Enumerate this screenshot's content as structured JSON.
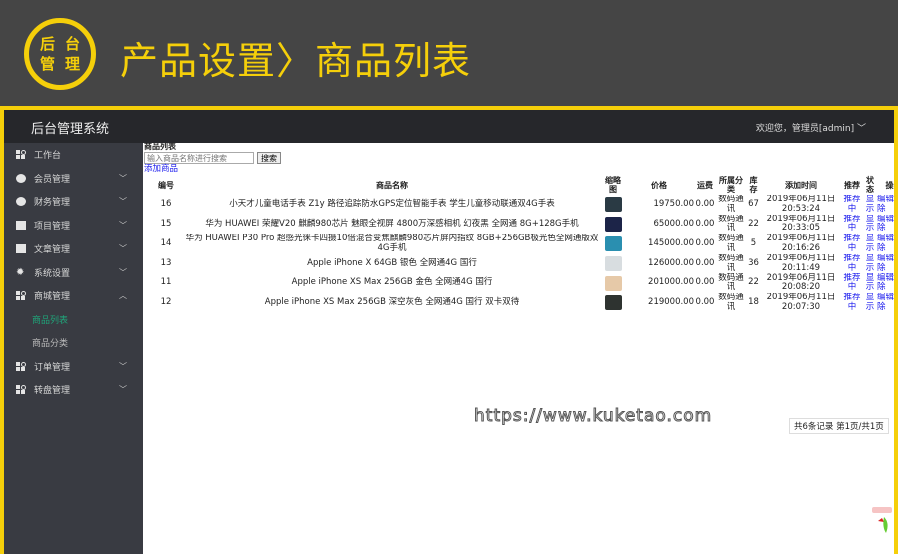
{
  "banner": {
    "seal_chars": [
      "后",
      "台",
      "管",
      "理"
    ],
    "title": "产品设置〉商品列表"
  },
  "header": {
    "system_name": "后台管理系统",
    "welcome": "欢迎您，管理员[admin]",
    "dropdown_icon": "chevron-down-icon"
  },
  "sidebar": {
    "items": [
      {
        "label": "工作台",
        "icon": "grid-icon"
      },
      {
        "label": "会员管理",
        "icon": "user-circle-icon",
        "chevron": "down"
      },
      {
        "label": "财务管理",
        "icon": "money-icon",
        "chevron": "down"
      },
      {
        "label": "项目管理",
        "icon": "project-icon",
        "chevron": "down"
      },
      {
        "label": "文章管理",
        "icon": "document-icon",
        "chevron": "down"
      },
      {
        "label": "系统设置",
        "icon": "gear-icon",
        "chevron": "down"
      },
      {
        "label": "商城管理",
        "icon": "grid-icon",
        "chevron": "up",
        "children": [
          {
            "label": "商品列表",
            "active": true
          },
          {
            "label": "商品分类"
          }
        ]
      },
      {
        "label": "订单管理",
        "icon": "grid-icon",
        "chevron": "down"
      },
      {
        "label": "转盘管理",
        "icon": "grid-icon",
        "chevron": "down"
      }
    ]
  },
  "main": {
    "breadcrumb": "商品列表",
    "search_placeholder": "输入商品名称进行搜索",
    "search_button": "搜索",
    "add_link": "添加商品",
    "columns": [
      "编号",
      "商品名称",
      "缩略图",
      "价格",
      "运费",
      "所属分类",
      "库存",
      "添加时间",
      "推荐",
      "状态",
      "操作"
    ],
    "rows": [
      {
        "id": "16",
        "name": "小天才儿童电话手表 Z1y 路径追踪防水GPS定位智能手表 学生儿童移动联通双4G手表",
        "price": "19750.00",
        "freight": "0.00",
        "category": "数码通讯",
        "stock": "67",
        "time": "2019年06月11日 20:53:24",
        "recommend": "推荐中",
        "status": "显示",
        "edit": "编辑",
        "delete": "删除",
        "thumb": "#2a3a44"
      },
      {
        "id": "15",
        "name": "华为 HUAWEI 荣耀V20 麒麟980芯片 魅眼全视屏 4800万深感相机 幻夜黑 全网通 8G+128G手机",
        "price": "65000.00",
        "freight": "0.00",
        "category": "数码通讯",
        "stock": "22",
        "time": "2019年06月11日 20:33:05",
        "recommend": "推荐中",
        "status": "显示",
        "edit": "编辑",
        "delete": "删除",
        "thumb": "#1c2448"
      },
      {
        "id": "14",
        "name": "华为 HUAWEI P30 Pro 超感光徕卡四摄10倍混合变焦麒麟980芯片屏内指纹 8GB+256GB极光色全网通版双4G手机",
        "price": "145000.00",
        "freight": "0.00",
        "category": "数码通讯",
        "stock": "5",
        "time": "2019年06月11日 20:16:26",
        "recommend": "推荐中",
        "status": "显示",
        "edit": "编辑",
        "delete": "删除",
        "thumb": "#2a8fb0"
      },
      {
        "id": "13",
        "name": "Apple iPhone X 64GB 银色 全网通4G 国行",
        "price": "126000.00",
        "freight": "0.00",
        "category": "数码通讯",
        "stock": "36",
        "time": "2019年06月11日 20:11:49",
        "recommend": "推荐中",
        "status": "显示",
        "edit": "编辑",
        "delete": "删除",
        "thumb": "#d8dde0"
      },
      {
        "id": "11",
        "name": "Apple iPhone XS Max 256GB 金色 全网通4G 国行",
        "price": "201000.00",
        "freight": "0.00",
        "category": "数码通讯",
        "stock": "22",
        "time": "2019年06月11日 20:08:20",
        "recommend": "推荐中",
        "status": "显示",
        "edit": "编辑",
        "delete": "删除",
        "thumb": "#e6c9a8"
      },
      {
        "id": "12",
        "name": "Apple iPhone XS Max 256GB 深空灰色 全网通4G 国行 双卡双待",
        "price": "219000.00",
        "freight": "0.00",
        "category": "数码通讯",
        "stock": "18",
        "time": "2019年06月11日 20:07:30",
        "recommend": "推荐中",
        "status": "显示",
        "edit": "编辑",
        "delete": "删除",
        "thumb": "#2e3330"
      }
    ],
    "pager": "共6条记录 第1页/共1页"
  },
  "watermark": "https://www.kuketao.com",
  "colors": {
    "accent": "#f5cf0a",
    "sidebar": "#393b42",
    "topbar": "#26272b",
    "active": "#1fa67a",
    "link": "#1a1aee"
  }
}
